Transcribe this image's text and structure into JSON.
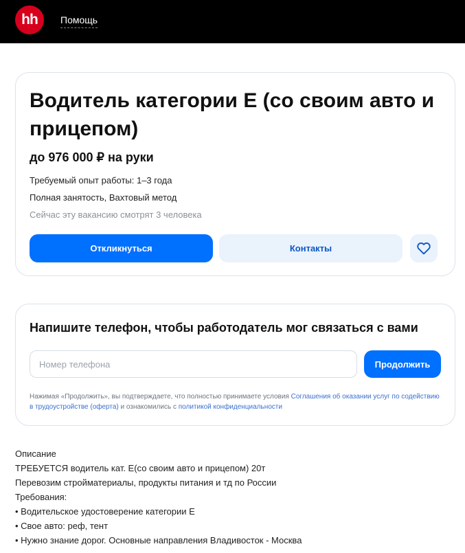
{
  "header": {
    "logo_text": "hh",
    "help_link": "Помощь"
  },
  "vacancy": {
    "title": "Водитель категории Е (со своим авто и прицепом)",
    "salary": "до 976 000 ₽ на руки",
    "experience": "Требуемый опыт работы: 1–3 года",
    "employment": "Полная занятость, Вахтовый метод",
    "viewers": "Сейчас эту вакансию смотрят 3 человека",
    "respond_button": "Откликнуться",
    "contacts_button": "Контакты",
    "favorite_icon": "heart-icon"
  },
  "phone_form": {
    "heading": "Напишите телефон, чтобы работодатель мог связаться с вами",
    "placeholder": "Номер телефона",
    "value": "",
    "continue_button": "Продолжить",
    "terms_prefix": "Нажимая «Продолжить», вы подтверждаете, что полностью принимаете условия ",
    "terms_link_offer": "Соглашения об оказании услуг по содействию в трудоустройстве (оферта)",
    "terms_middle": " и ознакомились с ",
    "terms_link_privacy": "политикой конфиденциальности"
  },
  "description": {
    "lines": [
      "Описание",
      "ТРЕБУЕТСЯ водитель кат. Е(со своим авто и прицепом) 20т",
      "Перевозим стройматериалы, продукты питания и тд по России",
      "Требования:",
      "• Водительское удостоверение категории Е",
      "• Свое авто: реф, тент",
      "• Нужно знание дорог. Основные направления Владивосток - Москва"
    ]
  },
  "colors": {
    "brand_red": "#d6001c",
    "accent_blue": "#0070ff",
    "secondary_button_bg": "#eaf2fc"
  }
}
